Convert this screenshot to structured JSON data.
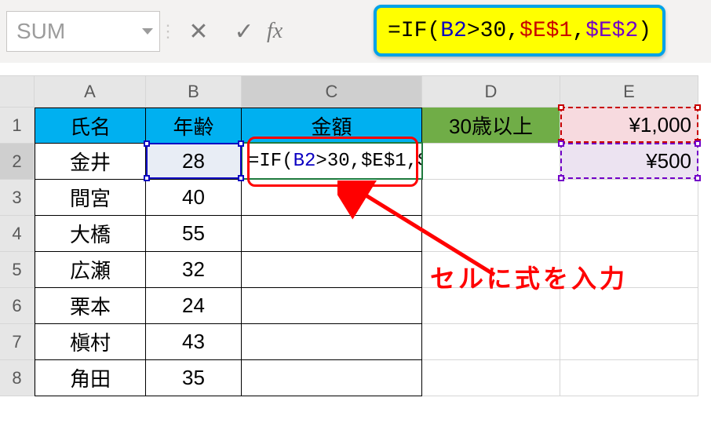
{
  "namebox": {
    "value": "SUM"
  },
  "fx_label": "fx",
  "formula_parts": {
    "a": "=IF(",
    "b2": "B2",
    "b": ">30,",
    "e1": "$E$1",
    "c": ",",
    "e2": "$E$2",
    "d": ")"
  },
  "col_headers": [
    "A",
    "B",
    "C",
    "D",
    "E"
  ],
  "row_headers": [
    "1",
    "2",
    "3",
    "4",
    "5",
    "6",
    "7",
    "8"
  ],
  "header_row": {
    "a": "氏名",
    "b": "年齢",
    "c": "金額",
    "d": "30歳以上",
    "e": "¥1,000"
  },
  "rows": [
    {
      "a": "金井",
      "b": "28",
      "c_formula": "=IF(B2>30,$E$1,$E$2)",
      "e": "¥500"
    },
    {
      "a": "間宮",
      "b": "40"
    },
    {
      "a": "大橋",
      "b": "55"
    },
    {
      "a": "広瀬",
      "b": "32"
    },
    {
      "a": "栗本",
      "b": "24"
    },
    {
      "a": "槇村",
      "b": "43"
    },
    {
      "a": "角田",
      "b": "35"
    }
  ],
  "callout": "セルに式を入力",
  "colors": {
    "marquee_e1": "#c80000",
    "marquee_e2": "#7300c8"
  }
}
